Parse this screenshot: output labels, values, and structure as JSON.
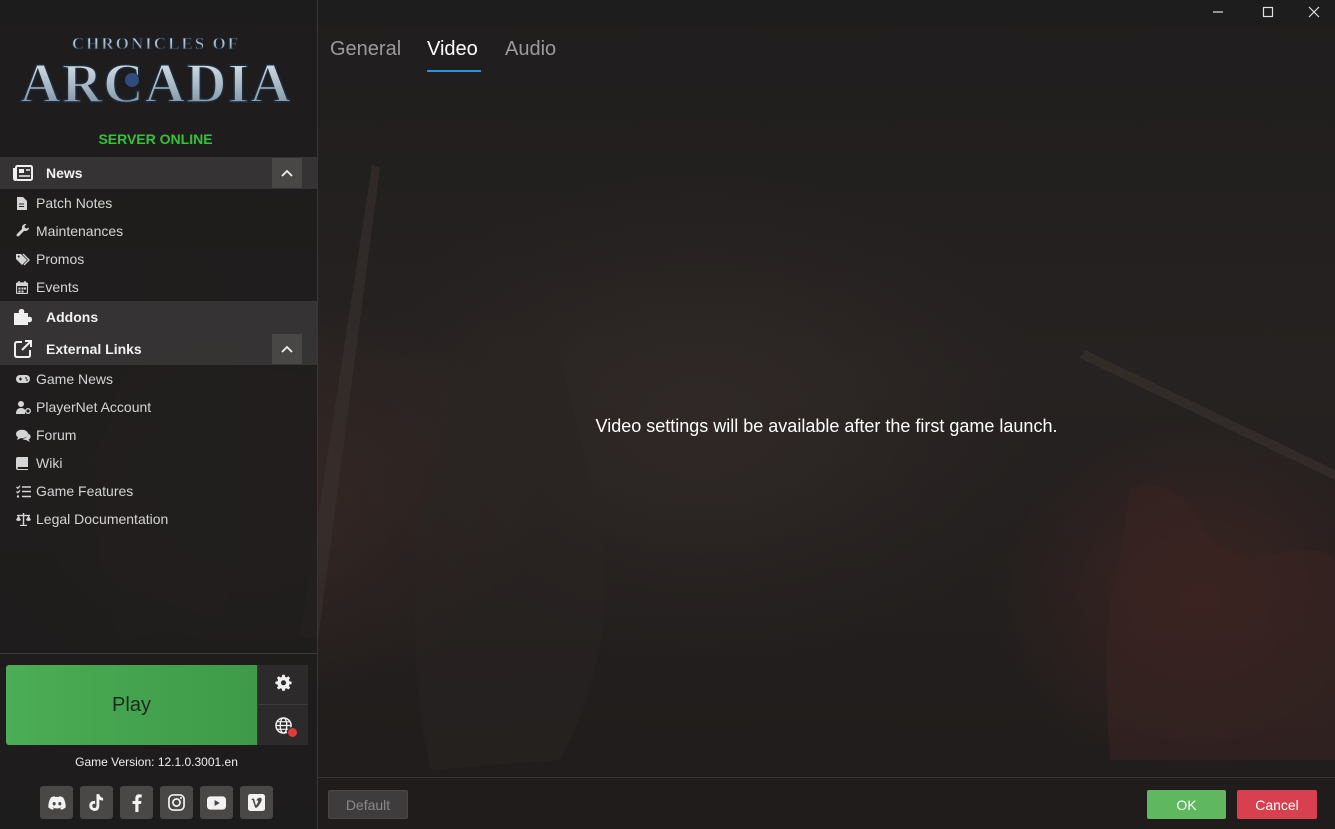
{
  "window": {
    "controls": {
      "minimize": "minimize-icon",
      "maximize": "maximize-icon",
      "close": "close-icon"
    }
  },
  "sidebar": {
    "logo": {
      "top_text": "CHRONICLES OF",
      "main_text": "ARCADIA"
    },
    "server_status": "SERVER ONLINE",
    "sections": {
      "news": {
        "label": "News",
        "icon": "newspaper-icon",
        "items": [
          {
            "label": "Patch Notes",
            "icon": "document-icon"
          },
          {
            "label": "Maintenances",
            "icon": "wrench-icon"
          },
          {
            "label": "Promos",
            "icon": "tags-icon"
          },
          {
            "label": "Events",
            "icon": "calendar-icon"
          }
        ]
      },
      "addons": {
        "label": "Addons",
        "icon": "puzzle-icon"
      },
      "external": {
        "label": "External Links",
        "icon": "external-link-icon",
        "items": [
          {
            "label": "Game News",
            "icon": "gamepad-icon"
          },
          {
            "label": "PlayerNet Account",
            "icon": "user-gear-icon"
          },
          {
            "label": "Forum",
            "icon": "comments-icon"
          },
          {
            "label": "Wiki",
            "icon": "book-icon"
          },
          {
            "label": "Game Features",
            "icon": "list-check-icon"
          },
          {
            "label": "Legal Documentation",
            "icon": "scale-icon"
          }
        ]
      }
    },
    "play": {
      "label": "Play"
    },
    "version": {
      "label": "Game Version: 12.1.0.3001.en"
    },
    "socials": [
      "discord-icon",
      "tiktok-icon",
      "facebook-icon",
      "instagram-icon",
      "youtube-icon",
      "vimeo-icon"
    ]
  },
  "main": {
    "tabs": [
      "General",
      "Video",
      "Audio"
    ],
    "active_tab": "Video",
    "message": "Video settings will be available after the first game launch."
  },
  "footer": {
    "default_label": "Default",
    "ok_label": "OK",
    "cancel_label": "Cancel"
  },
  "colors": {
    "server_online": "#35c23a",
    "play_button": "#4bad55",
    "ok_button": "#5fb760",
    "cancel_button": "#d9404f",
    "tab_accent": "#2f8fe0"
  }
}
